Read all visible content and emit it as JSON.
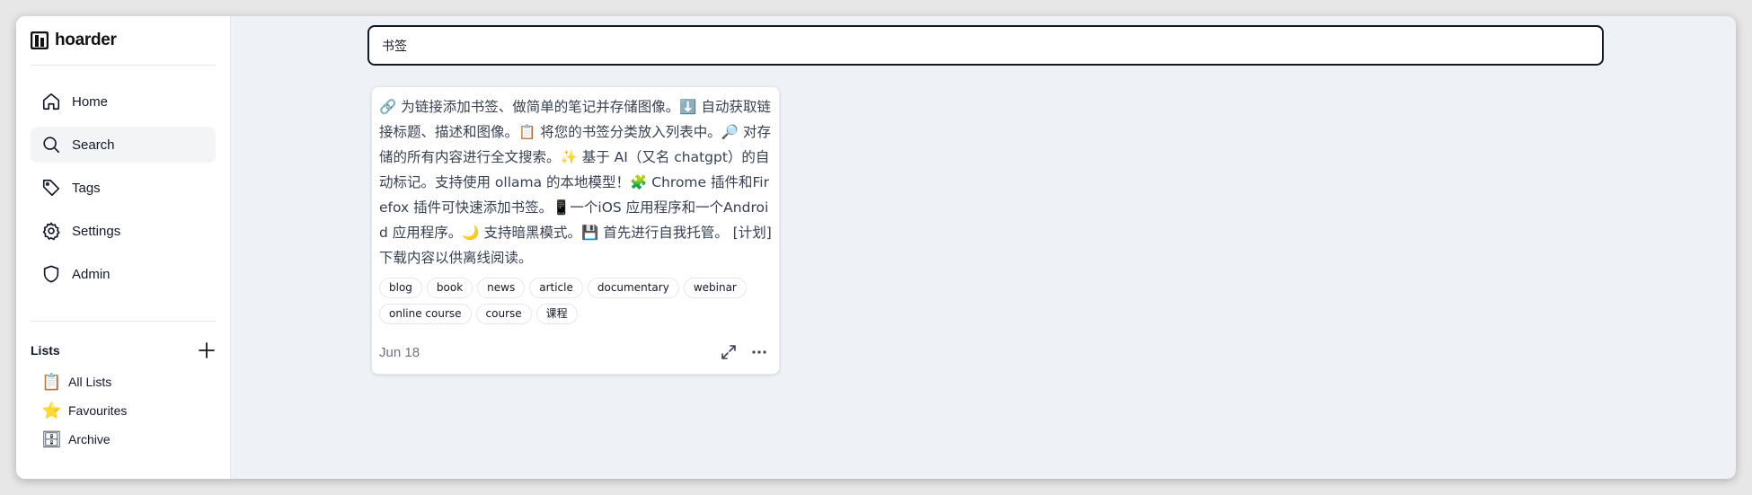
{
  "app": {
    "name": "hoarder"
  },
  "sidebar": {
    "nav": [
      {
        "label": "Home",
        "icon": "home-icon"
      },
      {
        "label": "Search",
        "icon": "search-icon",
        "active": true
      },
      {
        "label": "Tags",
        "icon": "tag-icon"
      },
      {
        "label": "Settings",
        "icon": "gear-icon"
      },
      {
        "label": "Admin",
        "icon": "shield-icon"
      }
    ],
    "lists_title": "Lists",
    "lists": [
      {
        "emoji": "📋",
        "label": "All Lists"
      },
      {
        "emoji": "⭐",
        "label": "Favourites"
      },
      {
        "emoji": "🗄",
        "label": "Archive"
      }
    ]
  },
  "search": {
    "value": "书签"
  },
  "card": {
    "text": "🔗 为链接添加书签、做简单的笔记并存储图像。⬇️ 自动获取链接标题、描述和图像。📋 将您的书签分类放入列表中。🔎 对存储的所有内容进行全文搜索。✨ 基于 AI（又名 chatgpt）的自动标记。支持使用 ollama 的本地模型！🧩 Chrome 插件和Firefox 插件可快速添加书签。📱一个iOS 应用程序和一个Android 应用程序。🌙 支持暗黑模式。💾 首先进行自我托管。 [计划] 下载内容以供离线阅读。",
    "tags": [
      "blog",
      "book",
      "news",
      "article",
      "documentary",
      "webinar",
      "online course",
      "course",
      "课程"
    ],
    "date": "Jun 18"
  }
}
